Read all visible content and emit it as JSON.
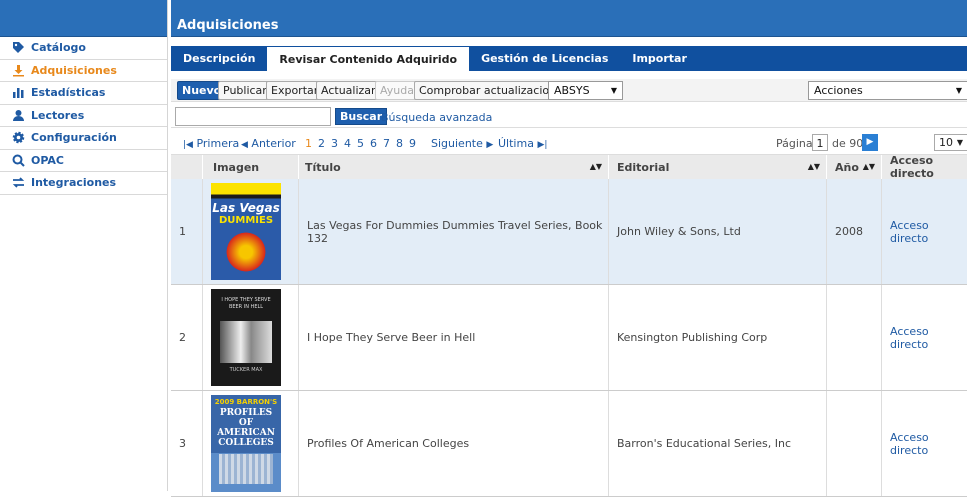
{
  "sidebar": {
    "items": [
      {
        "label": "Catálogo",
        "icon": "tag-icon",
        "active": false
      },
      {
        "label": "Adquisiciones",
        "icon": "download-icon",
        "active": true
      },
      {
        "label": "Estadísticas",
        "icon": "bar-chart-icon",
        "active": false
      },
      {
        "label": "Lectores",
        "icon": "user-icon",
        "active": false
      },
      {
        "label": "Configuración",
        "icon": "gear-icon",
        "active": false
      },
      {
        "label": "OPAC",
        "icon": "search-icon",
        "active": false
      },
      {
        "label": "Integraciones",
        "icon": "sync-icon",
        "active": false
      }
    ]
  },
  "header": {
    "title": "Adquisiciones"
  },
  "tabs": [
    {
      "label": "Descripción"
    },
    {
      "label": "Revisar Contenido Adquirido"
    },
    {
      "label": "Gestión de Licencias"
    },
    {
      "label": "Importar"
    }
  ],
  "toolbar": {
    "nuevo": "Nuevo",
    "publicar": "Publicar",
    "exportar": "Exportar",
    "actualizar": "Actualizar",
    "ayuda": "Ayuda",
    "comprobar": "Comprobar actualizaciones",
    "source_select": "ABSYS",
    "actions_select": "Acciones"
  },
  "search": {
    "button": "Buscar",
    "advanced": "Búsqueda avanzada",
    "value": ""
  },
  "pager": {
    "first": "Primera",
    "prev": "Anterior",
    "pages": [
      "1",
      "2",
      "3",
      "4",
      "5",
      "6",
      "7",
      "8",
      "9"
    ],
    "next": "Siguiente",
    "last": "Última",
    "page_label": "Página",
    "page_value": "1",
    "of_label": "de 90",
    "per_page": "10"
  },
  "table": {
    "headers": {
      "imagen": "Imagen",
      "titulo": "Título",
      "editorial": "Editorial",
      "anio": "Año",
      "acceso": "Acceso directo"
    },
    "rows": [
      {
        "num": "1",
        "cover_text": "Las Vegas",
        "cover_sub": "DUMMIES",
        "title": "Las Vegas For Dummies Dummies Travel Series, Book 132",
        "editorial": "John Wiley & Sons, Ltd",
        "year": "2008",
        "link": "Acceso directo"
      },
      {
        "num": "2",
        "cover_text": "I HOPE THEY SERVE BEER IN HELL",
        "cover_sub": "TUCKER MAX",
        "title": "I Hope They Serve Beer in Hell",
        "editorial": "Kensington Publishing Corp",
        "year": "",
        "link": "Acceso directo"
      },
      {
        "num": "3",
        "cover_text": "PROFILES OF AMERICAN COLLEGES",
        "cover_sub": "2009 BARRON'S",
        "title": "Profiles Of American Colleges",
        "editorial": "Barron's Educational Series, Inc",
        "year": "",
        "link": "Acceso directo"
      }
    ]
  }
}
